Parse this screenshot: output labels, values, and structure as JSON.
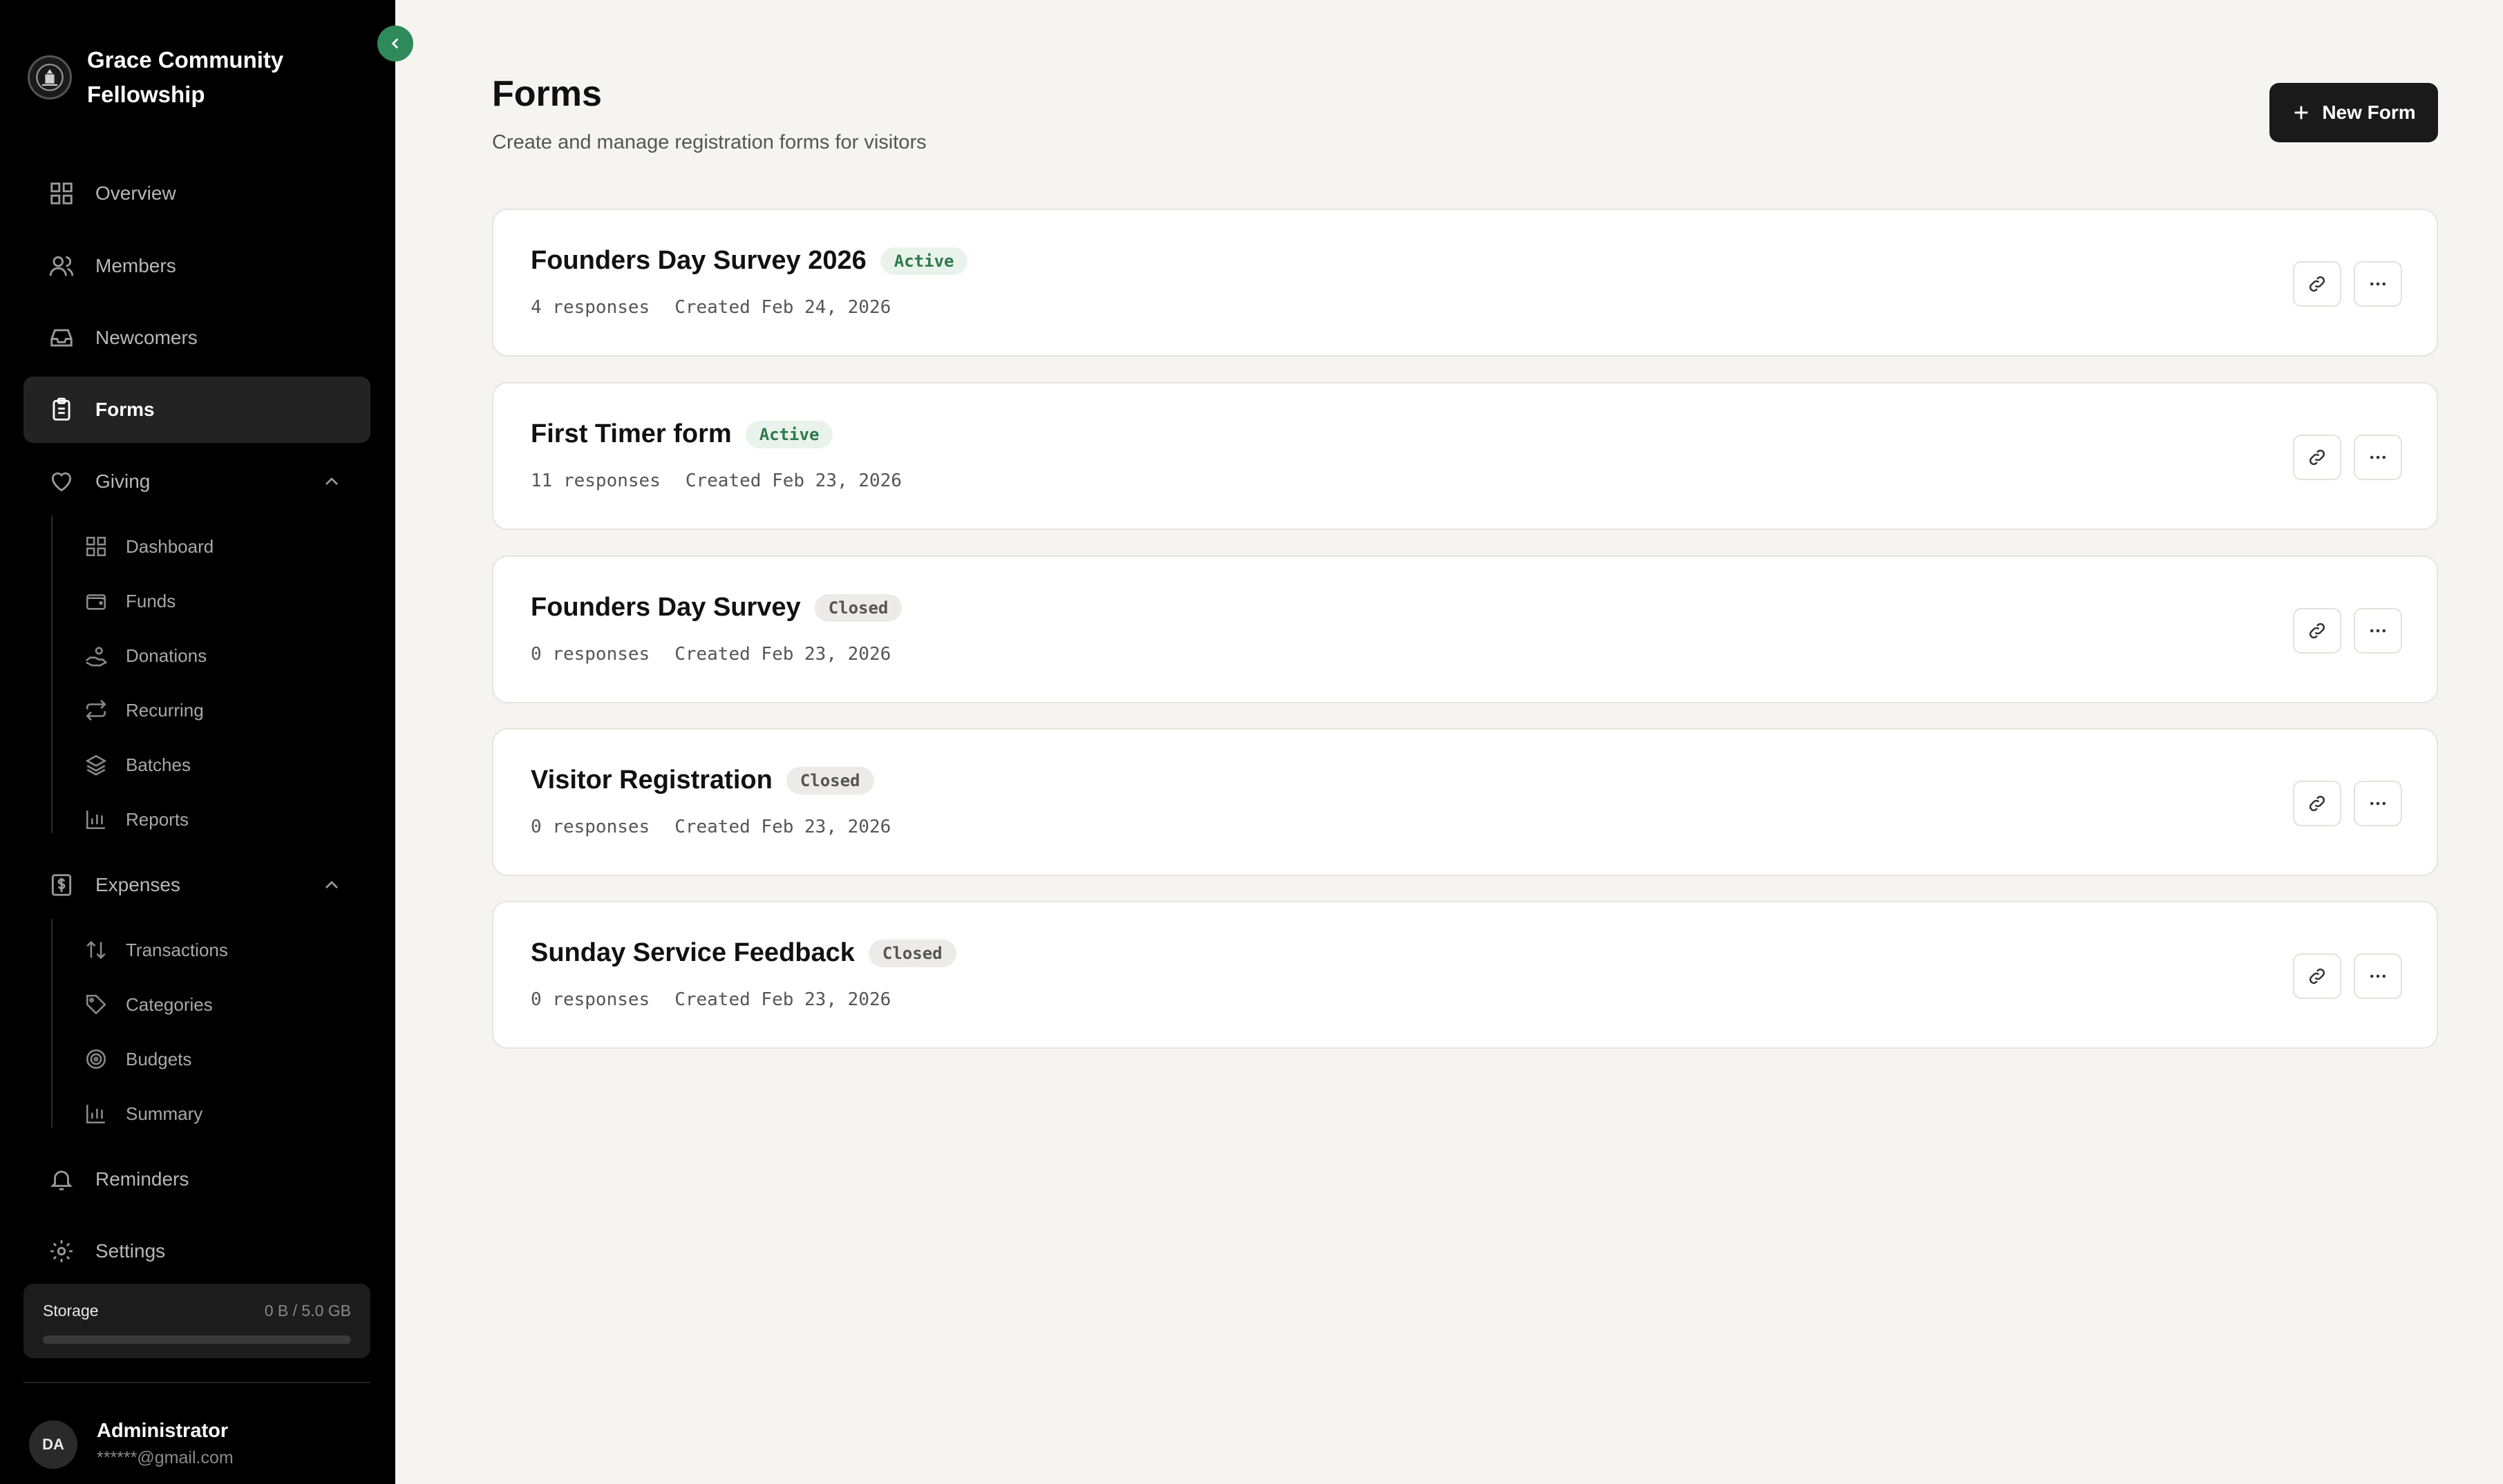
{
  "sidebar": {
    "org_name": "Grace Community Fellowship",
    "nav": {
      "overview": "Overview",
      "members": "Members",
      "newcomers": "Newcomers",
      "forms": "Forms",
      "giving": "Giving",
      "expenses": "Expenses",
      "reminders": "Reminders",
      "settings": "Settings"
    },
    "giving_items": [
      "Dashboard",
      "Funds",
      "Donations",
      "Recurring",
      "Batches",
      "Reports"
    ],
    "expenses_items": [
      "Transactions",
      "Categories",
      "Budgets",
      "Summary"
    ],
    "storage": {
      "label": "Storage",
      "value": "0 B / 5.0 GB",
      "fill_fraction": 0
    },
    "user": {
      "initials": "DA",
      "name": "Administrator",
      "email": "******@gmail.com"
    }
  },
  "main": {
    "title": "Forms",
    "subtitle": "Create and manage registration forms for visitors",
    "new_button": "New Form",
    "forms": [
      {
        "title": "Founders Day Survey 2026",
        "status": "Active",
        "responses": "4 responses",
        "created": "Created Feb 24, 2026"
      },
      {
        "title": "First Timer form",
        "status": "Active",
        "responses": "11 responses",
        "created": "Created Feb 23, 2026"
      },
      {
        "title": "Founders Day Survey",
        "status": "Closed",
        "responses": "0 responses",
        "created": "Created Feb 23, 2026"
      },
      {
        "title": "Visitor Registration",
        "status": "Closed",
        "responses": "0 responses",
        "created": "Created Feb 23, 2026"
      },
      {
        "title": "Sunday Service Feedback",
        "status": "Closed",
        "responses": "0 responses",
        "created": "Created Feb 23, 2026"
      }
    ]
  },
  "colors": {
    "accent_green": "#2f8a5a",
    "active_badge_text": "#2f7a4d",
    "sidebar_bg": "#000000",
    "page_bg": "#f5f4f1"
  }
}
